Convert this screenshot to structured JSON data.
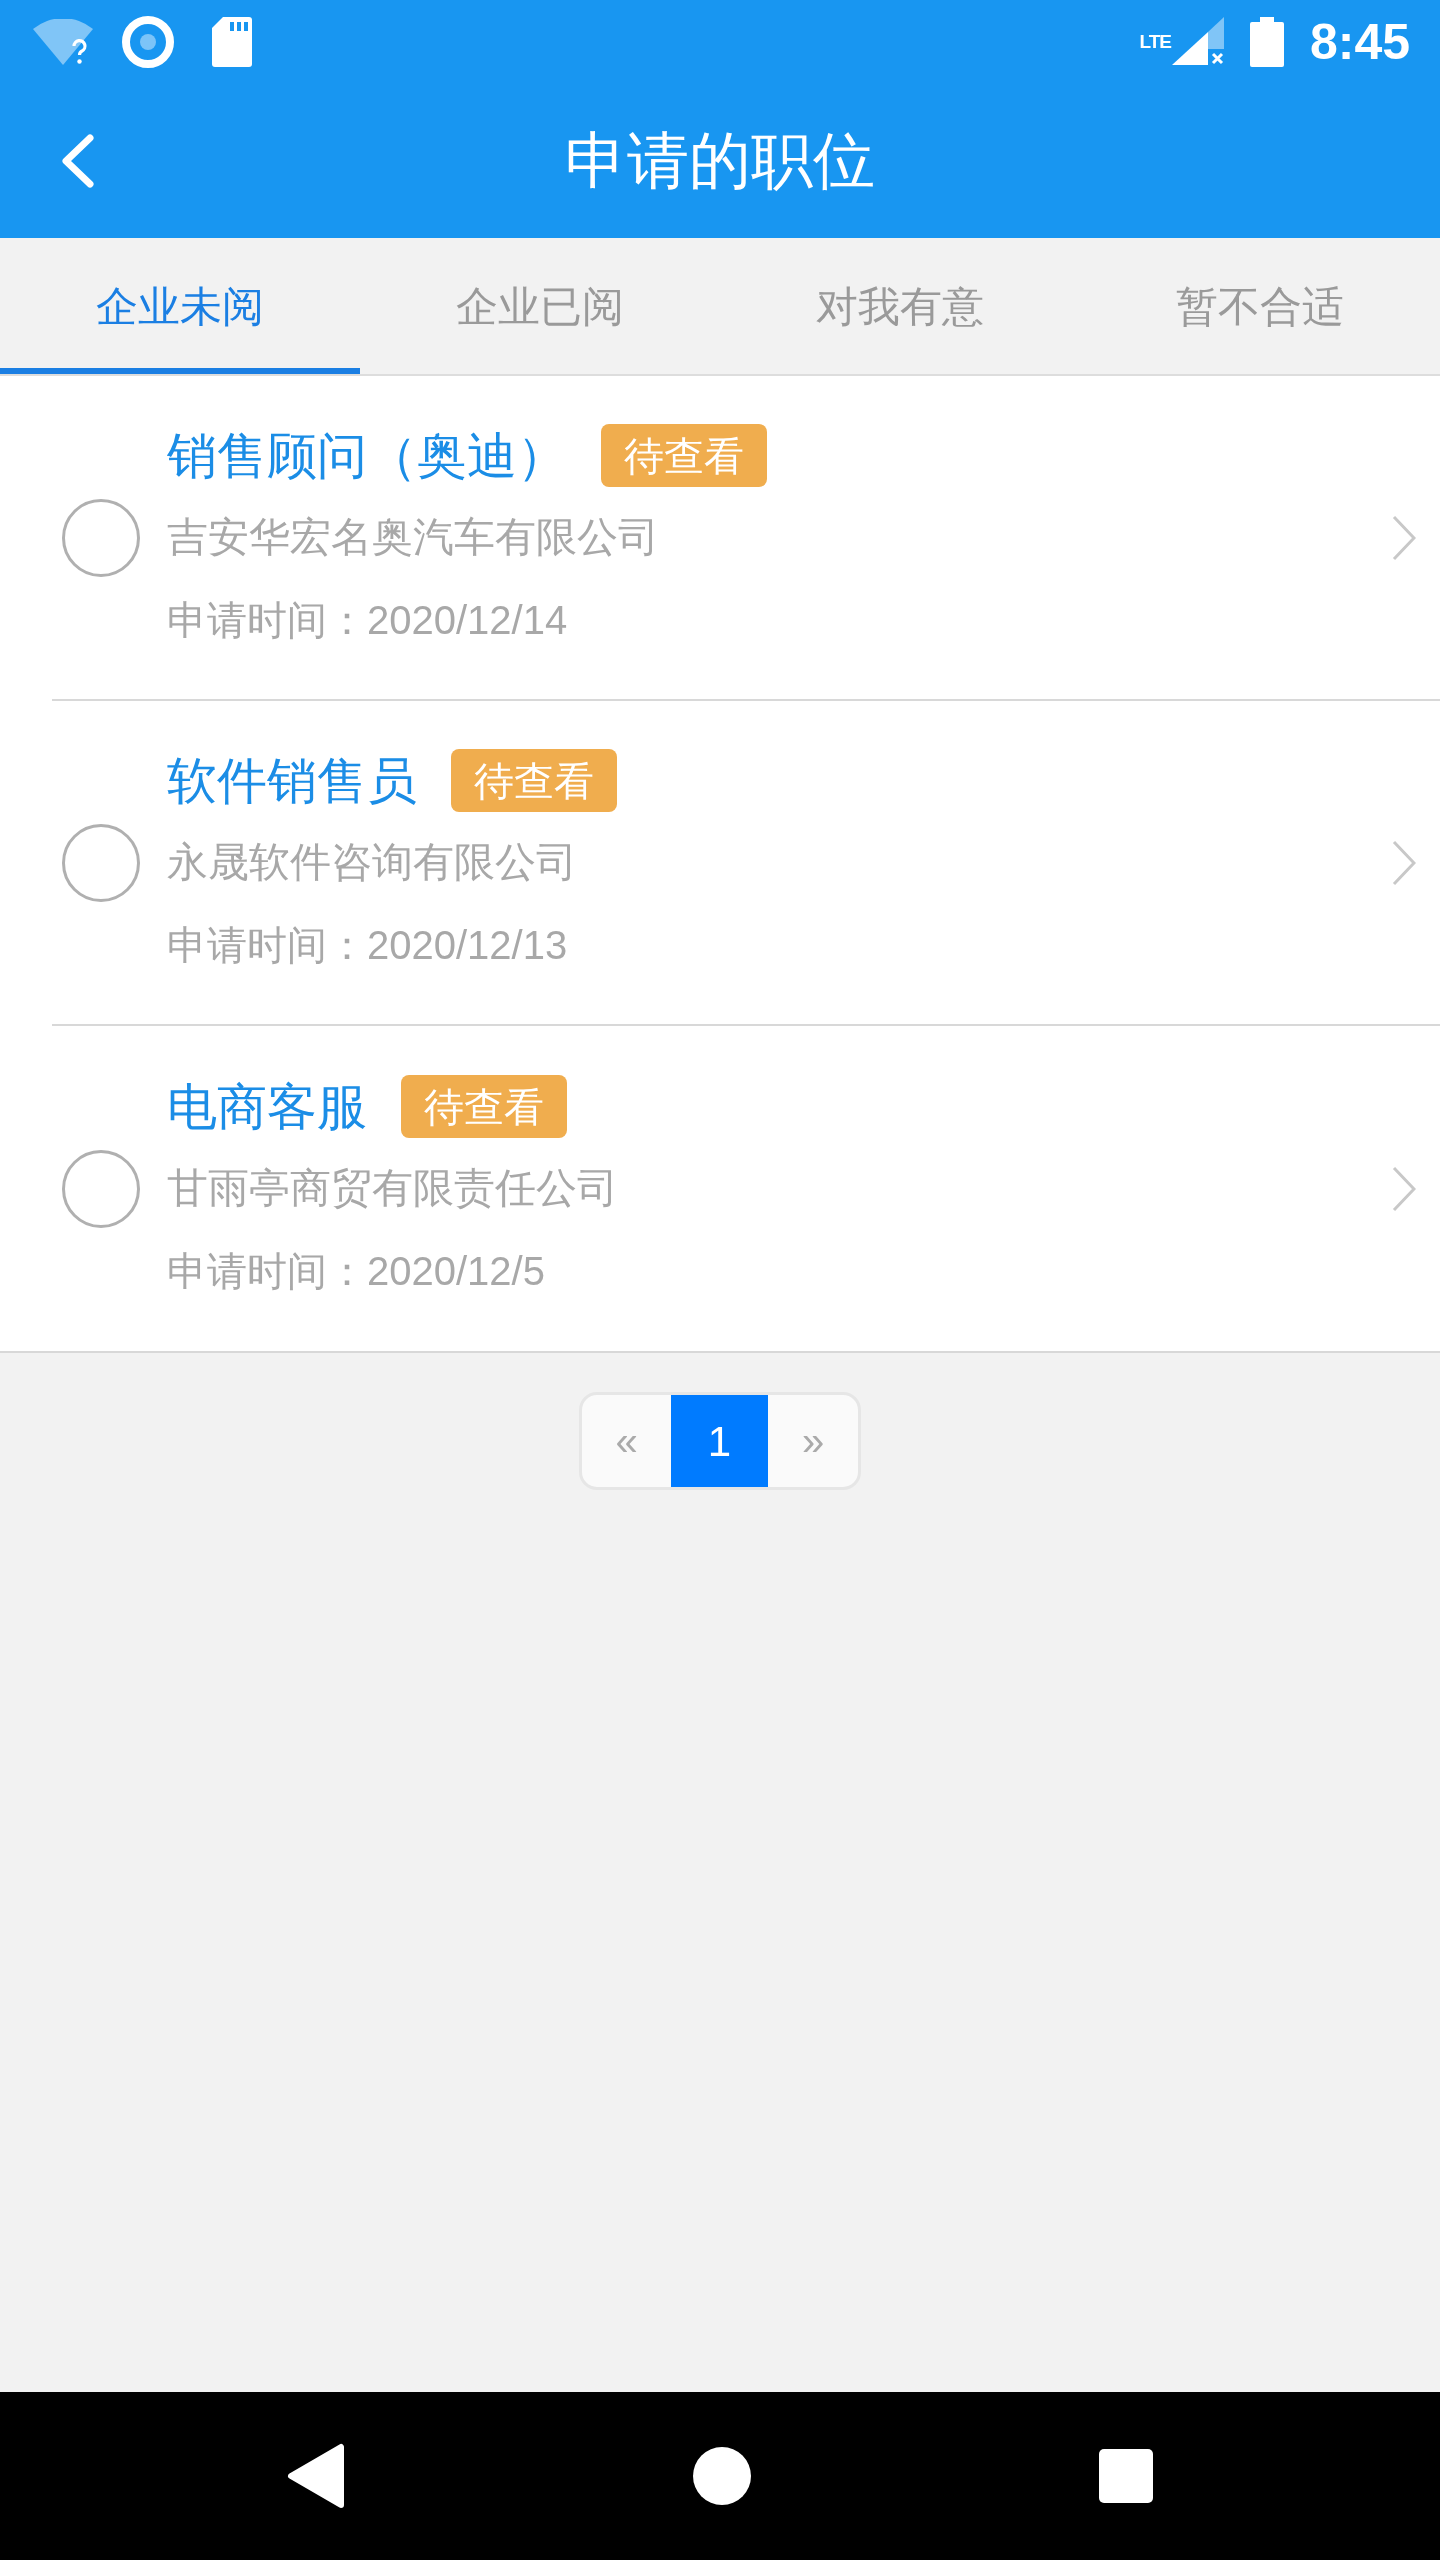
{
  "status_bar": {
    "network_type": "LTE",
    "time": "8:45"
  },
  "header": {
    "title": "申请的职位"
  },
  "tabs": [
    {
      "label": "企业未阅",
      "selected": true
    },
    {
      "label": "企业已阅",
      "selected": false
    },
    {
      "label": "对我有意",
      "selected": false
    },
    {
      "label": "暂不合适",
      "selected": false
    }
  ],
  "applications": [
    {
      "position": "销售顾问（奥迪）",
      "status": "待查看",
      "company": "吉安华宏名奥汽车有限公司",
      "applied_at": "申请时间：2020/12/14",
      "checked": false
    },
    {
      "position": "软件销售员",
      "status": "待查看",
      "company": "永晟软件咨询有限公司",
      "applied_at": "申请时间：2020/12/13",
      "checked": false
    },
    {
      "position": "电商客服",
      "status": "待查看",
      "company": "甘雨亭商贸有限责任公司",
      "applied_at": "申请时间：2020/12/5",
      "checked": false
    }
  ],
  "pagination": {
    "previous": "«",
    "pages": [
      {
        "label": "1",
        "selected": true
      }
    ],
    "next": "»"
  }
}
